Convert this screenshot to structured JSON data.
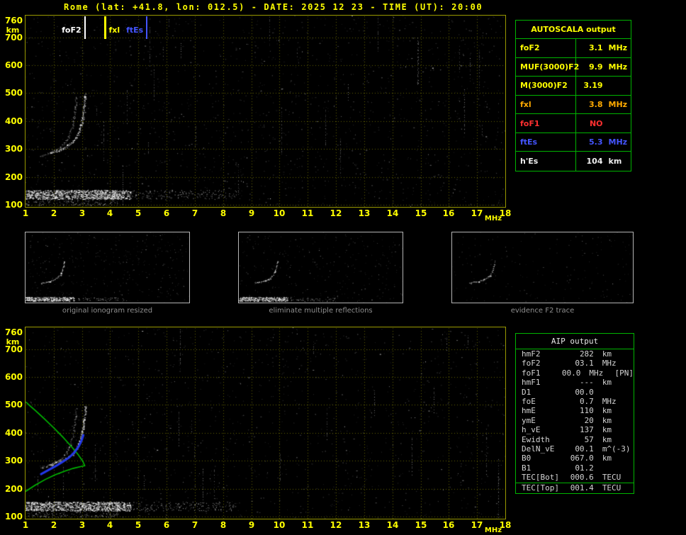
{
  "title": "Rome (lat: +41.8, lon: 012.5) - DATE: 2025 12 23 - TIME (UT): 20:00",
  "colors": {
    "background": "#000000",
    "axis_text": "#ffff00",
    "plot_border": "#999900",
    "grid_dots": "#636300",
    "table_border": "#00b400",
    "caption_text": "#8f8f8f",
    "aip_text": "#d4d4d4",
    "profile_green": "#00bb00",
    "restored_trace_blue": "#2238e8",
    "marker_foF2": "#ffffff",
    "marker_fxl": "#ffff00",
    "marker_ftEs": "#4455ff"
  },
  "top_plot": {
    "y_unit": "km",
    "x_unit": "MHz",
    "markers": [
      {
        "label": "foF2",
        "mhz": 3.1,
        "color": "#ffffff",
        "side": "left"
      },
      {
        "label": "fxl",
        "mhz": 3.8,
        "color": "#ffff00",
        "side": "right"
      },
      {
        "label": "ftEs",
        "mhz": 5.3,
        "color": "#4455ff",
        "side": "left"
      }
    ]
  },
  "bottom_plot": {
    "y_unit": "km",
    "x_unit": "MHz"
  },
  "autoscala_table": {
    "title": "AUTOSCALA output",
    "rows": [
      {
        "param": "foF2",
        "num": "3.1",
        "unit": "MHz",
        "color": "#ffff00"
      },
      {
        "param": "MUF(3000)F2",
        "num": "9.9",
        "unit": "MHz",
        "color": "#ffff00"
      },
      {
        "param": "M(3000)F2",
        "num": "3.19",
        "unit": "",
        "color": "#ffff00"
      },
      {
        "param": "fxl",
        "num": "3.8",
        "unit": "MHz",
        "color": "#ffaa00"
      },
      {
        "param": "foF1",
        "num": "NO",
        "unit": "",
        "color": "#ff3030"
      },
      {
        "param": "ftEs",
        "num": "5.3",
        "unit": "MHz",
        "color": "#4455ff"
      },
      {
        "param": "h'Es",
        "num": "104",
        "unit": "km",
        "color": "#f0f0f0"
      }
    ]
  },
  "thumbnails": [
    {
      "caption": "original ionogram resized"
    },
    {
      "caption": "eliminate multiple reflections"
    },
    {
      "caption": "evidence F2 trace"
    }
  ],
  "aip_table": {
    "title": "AIP output",
    "rows": [
      {
        "name": "hmF2",
        "value": "282",
        "unit": "km",
        "extra": ""
      },
      {
        "name": "foF2",
        "value": "03.1",
        "unit": "MHz",
        "extra": ""
      },
      {
        "name": "foF1",
        "value": "00.0",
        "unit": "MHz",
        "extra": "[PN]"
      },
      {
        "name": "hmF1",
        "value": "---",
        "unit": "km",
        "extra": ""
      },
      {
        "name": "D1",
        "value": "00.0",
        "unit": "",
        "extra": ""
      },
      {
        "name": "foE",
        "value": "0.7",
        "unit": "MHz",
        "extra": ""
      },
      {
        "name": "hmE",
        "value": "110",
        "unit": "km",
        "extra": ""
      },
      {
        "name": "ymE",
        "value": "20",
        "unit": "km",
        "extra": ""
      },
      {
        "name": "h_vE",
        "value": "137",
        "unit": "km",
        "extra": ""
      },
      {
        "name": "Ewidth",
        "value": "57",
        "unit": "km",
        "extra": ""
      },
      {
        "name": "DelN_vE",
        "value": "00.1",
        "unit": "m^(-3)",
        "extra": ""
      },
      {
        "name": "B0",
        "value": "067.0",
        "unit": "km",
        "extra": ""
      },
      {
        "name": "B1",
        "value": "01.2",
        "unit": "",
        "extra": ""
      }
    ],
    "tec_rows": [
      {
        "name": "TEC[Bot]",
        "value": "000.6",
        "unit": "TECU"
      },
      {
        "name": "TEC[Top]",
        "value": "001.4",
        "unit": "TECU"
      }
    ]
  },
  "chart_data": [
    {
      "type": "scatter",
      "panel": "main-ionogram",
      "title": "",
      "xlabel": "MHz",
      "ylabel": "km",
      "xlim": [
        1,
        18
      ],
      "ylim": [
        88,
        768
      ],
      "x_ticks": [
        1,
        2,
        3,
        4,
        5,
        6,
        7,
        8,
        9,
        10,
        11,
        12,
        13,
        14,
        15,
        16,
        17,
        18
      ],
      "y_ticks": [
        100,
        200,
        300,
        400,
        500,
        600,
        700,
        760
      ],
      "grid": "dotted",
      "scaled_values": {
        "foF2_mhz": 3.1,
        "fxl_mhz": 3.8,
        "ftEs_mhz": 5.3
      },
      "f2_trace_mhz_km": [
        [
          1.85,
          286
        ],
        [
          2.0,
          291
        ],
        [
          2.15,
          296
        ],
        [
          2.3,
          302
        ],
        [
          2.45,
          310
        ],
        [
          2.6,
          320
        ],
        [
          2.72,
          333
        ],
        [
          2.82,
          348
        ],
        [
          2.9,
          366
        ],
        [
          2.96,
          386
        ],
        [
          3.01,
          408
        ],
        [
          3.05,
          430
        ],
        [
          3.08,
          455
        ],
        [
          3.1,
          478
        ],
        [
          3.11,
          500
        ]
      ],
      "es_layer": {
        "height_km": 105,
        "dense_mhz": [
          1.0,
          4.7
        ],
        "sparse_mhz": [
          4.7,
          8.2
        ]
      }
    },
    {
      "type": "scatter",
      "panel": "profile-inversion",
      "title": "",
      "xlabel": "MHz",
      "ylabel": "km",
      "xlim": [
        1,
        18
      ],
      "ylim": [
        88,
        768
      ],
      "x_ticks": [
        1,
        2,
        3,
        4,
        5,
        6,
        7,
        8,
        9,
        10,
        11,
        12,
        13,
        14,
        15,
        16,
        17,
        18
      ],
      "y_ticks": [
        100,
        200,
        300,
        400,
        500,
        600,
        700,
        760
      ],
      "grid": "dotted",
      "f2_trace_mhz_km": [
        [
          1.85,
          286
        ],
        [
          2.0,
          291
        ],
        [
          2.15,
          296
        ],
        [
          2.3,
          302
        ],
        [
          2.45,
          310
        ],
        [
          2.6,
          320
        ],
        [
          2.72,
          333
        ],
        [
          2.82,
          348
        ],
        [
          2.9,
          366
        ],
        [
          2.96,
          386
        ],
        [
          3.01,
          408
        ],
        [
          3.05,
          430
        ],
        [
          3.08,
          455
        ],
        [
          3.1,
          478
        ],
        [
          3.11,
          500
        ]
      ],
      "electron_density_profile_mhz_km": [
        [
          1.0,
          190
        ],
        [
          1.35,
          213
        ],
        [
          1.7,
          233
        ],
        [
          2.05,
          250
        ],
        [
          2.4,
          263
        ],
        [
          2.7,
          273
        ],
        [
          2.95,
          279
        ],
        [
          3.1,
          282
        ],
        [
          3.03,
          298
        ],
        [
          2.88,
          320
        ],
        [
          2.65,
          348
        ],
        [
          2.35,
          382
        ],
        [
          2.0,
          418
        ],
        [
          1.65,
          452
        ],
        [
          1.35,
          480
        ],
        [
          1.12,
          500
        ],
        [
          1.02,
          510
        ]
      ],
      "restored_trace_mhz_km": [
        [
          1.55,
          252
        ],
        [
          1.8,
          266
        ],
        [
          2.05,
          280
        ],
        [
          2.3,
          295
        ],
        [
          2.55,
          312
        ],
        [
          2.75,
          332
        ],
        [
          2.9,
          354
        ],
        [
          3.0,
          376
        ],
        [
          3.05,
          392
        ]
      ],
      "es_layer": {
        "height_km": 105,
        "dense_mhz": [
          1.0,
          4.7
        ],
        "sparse_mhz": [
          4.7,
          8.2
        ]
      }
    }
  ]
}
